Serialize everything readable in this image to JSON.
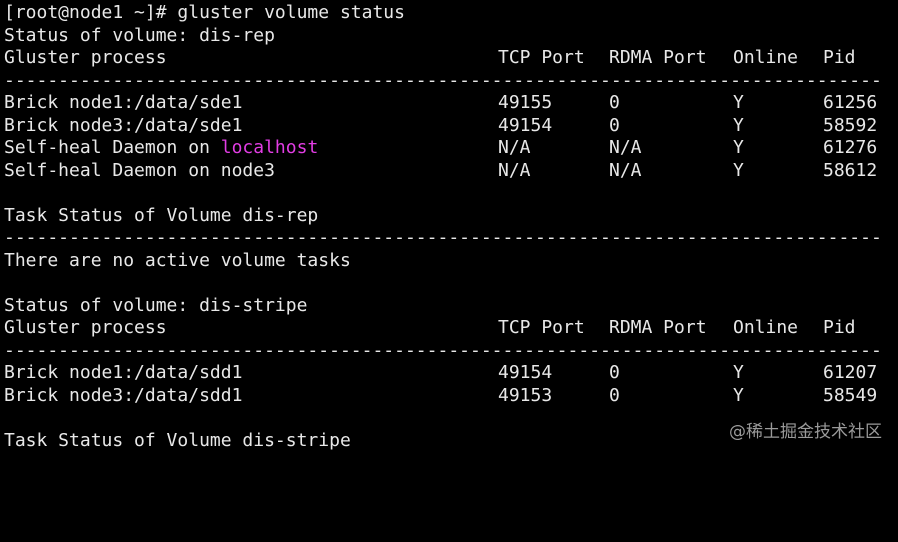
{
  "prompt": {
    "text": "[root@node1 ~]# gluster volume status"
  },
  "headers": {
    "process": "Gluster process",
    "tcp": "TCP Port",
    "rdma": "RDMA Port",
    "online": "Online",
    "pid": "Pid"
  },
  "separator": "------------------------------------------------------------------------------------------------------------------------",
  "vol1": {
    "status_title": "Status of volume: dis-rep",
    "rows": [
      {
        "process": "Brick node1:/data/sde1",
        "tcp": "49155",
        "rdma": "0",
        "online": "Y",
        "pid": "61256"
      },
      {
        "process": "Brick node3:/data/sde1",
        "tcp": "49154",
        "rdma": "0",
        "online": "Y",
        "pid": "58592"
      },
      {
        "process_prefix": "Self-heal Daemon on ",
        "process_host": "localhost",
        "tcp": "N/A",
        "rdma": "N/A",
        "online": "Y",
        "pid": "61276"
      },
      {
        "process": "Self-heal Daemon on node3",
        "tcp": "N/A",
        "rdma": "N/A",
        "online": "Y",
        "pid": "58612"
      }
    ],
    "task_title": "Task Status of Volume dis-rep",
    "task_message": "There are no active volume tasks"
  },
  "vol2": {
    "status_title": "Status of volume: dis-stripe",
    "rows": [
      {
        "process": "Brick node1:/data/sdd1",
        "tcp": "49154",
        "rdma": "0",
        "online": "Y",
        "pid": "61207"
      },
      {
        "process": "Brick node3:/data/sdd1",
        "tcp": "49153",
        "rdma": "0",
        "online": "Y",
        "pid": "58549"
      }
    ],
    "task_title": "Task Status of Volume dis-stripe"
  },
  "watermark": {
    "text": "@稀土掘金技术社区"
  },
  "colors": {
    "background": "#000000",
    "foreground": "#e8e8e8",
    "highlight": "#e23de4"
  }
}
